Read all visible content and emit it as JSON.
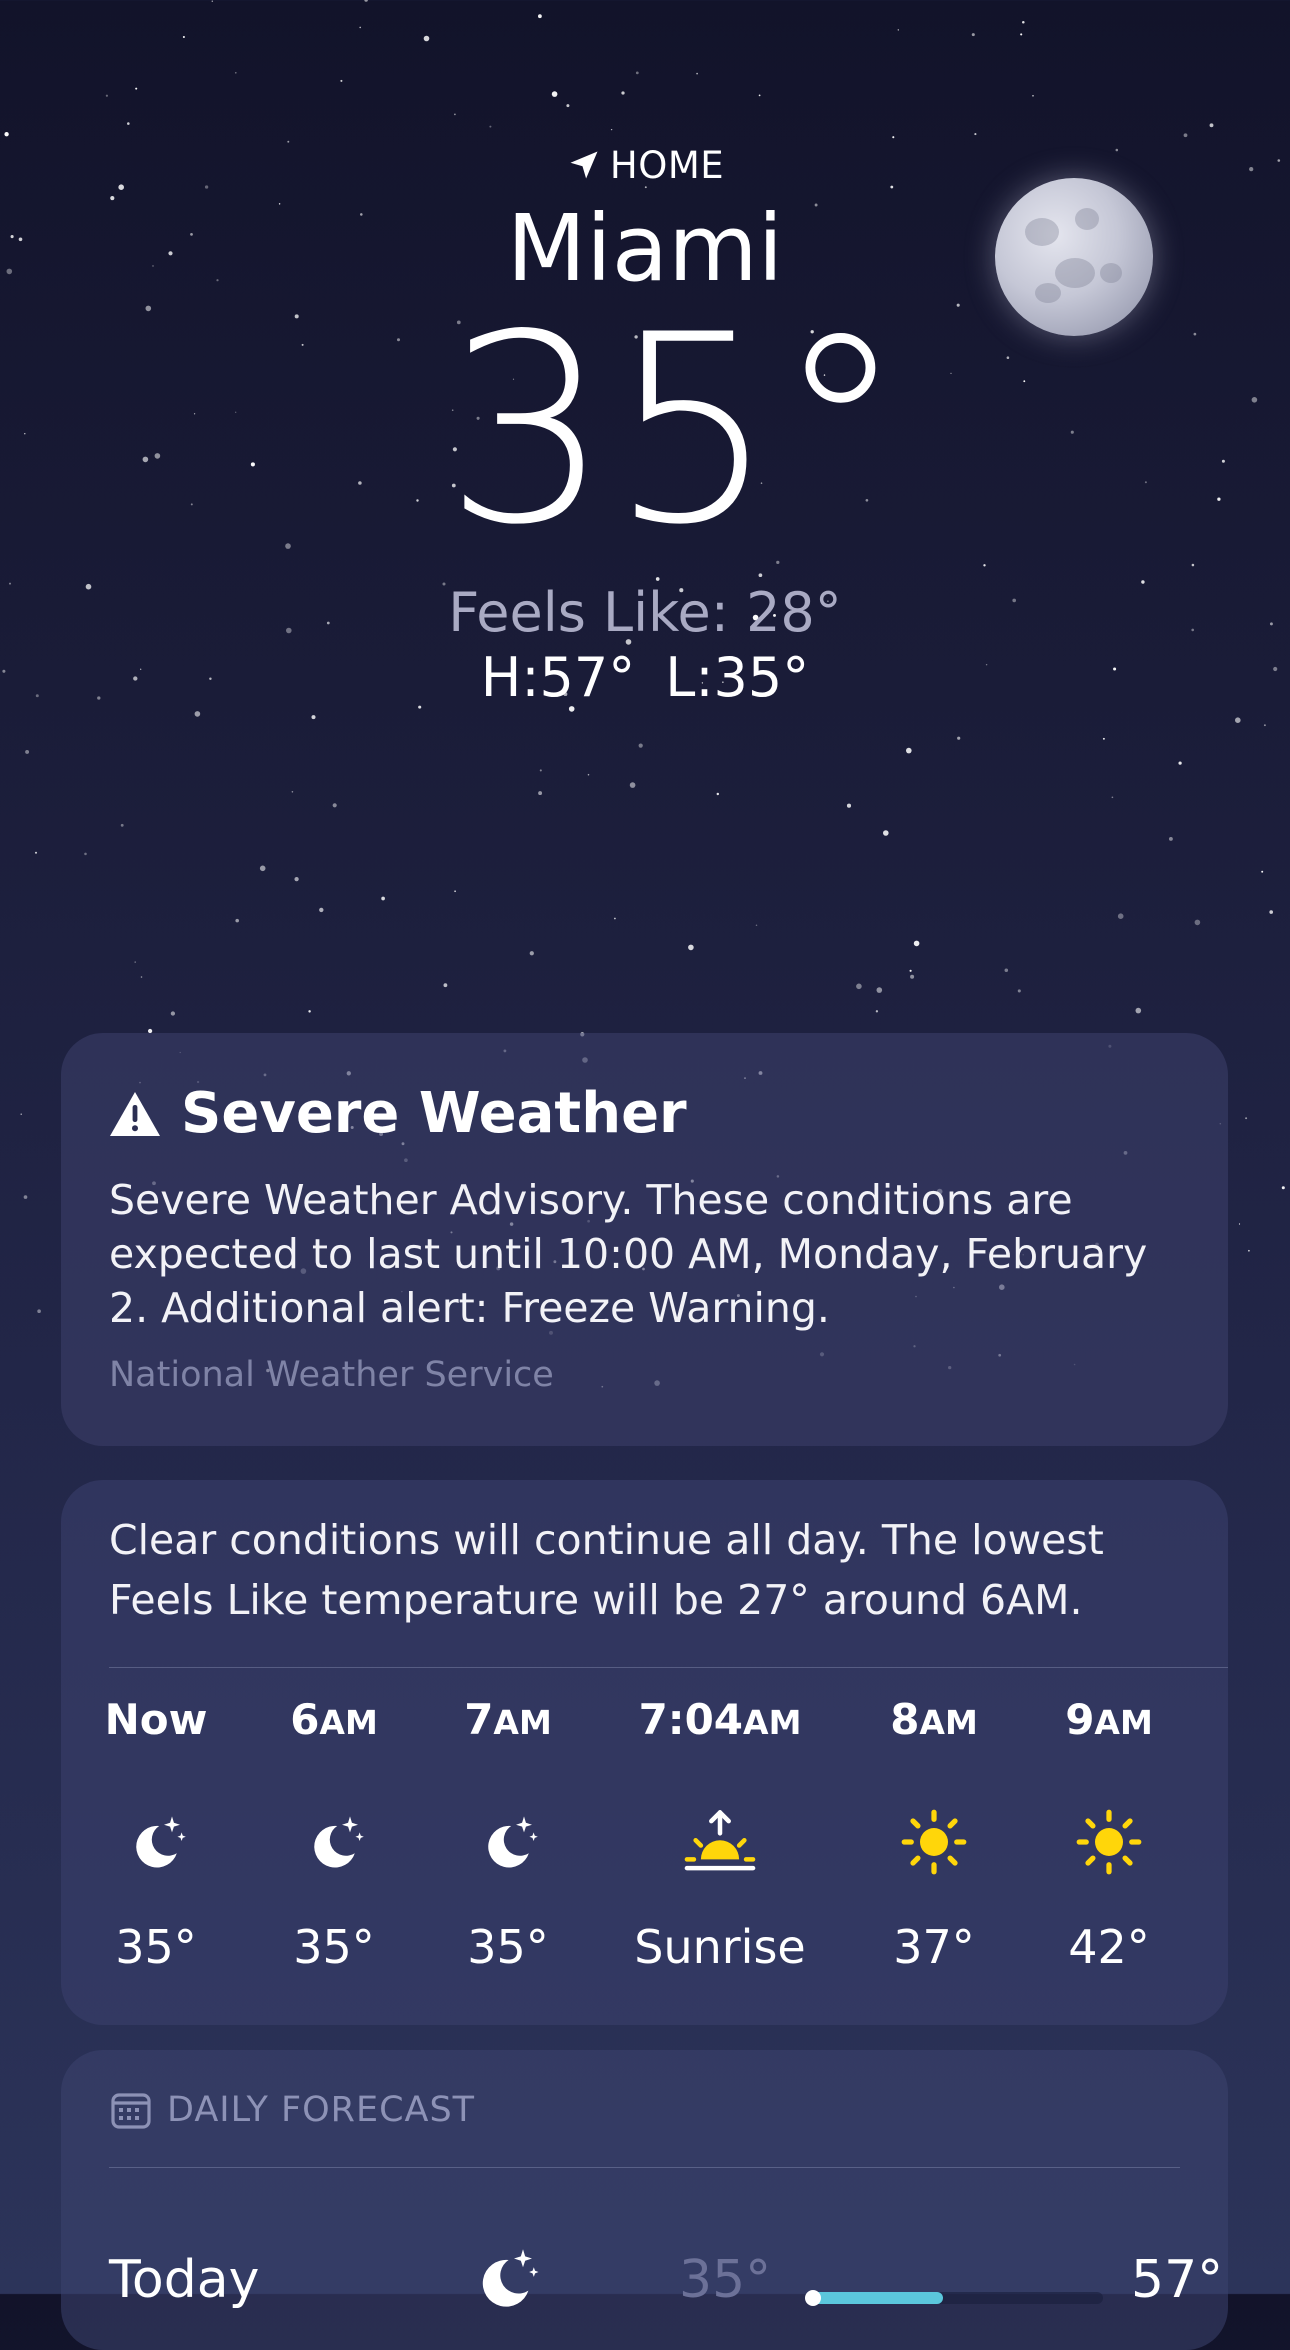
{
  "location": {
    "home_label": "HOME",
    "city": "Miami"
  },
  "current": {
    "temperature": "35°",
    "feels_like": "Feels Like: 28°",
    "high": "H:57°",
    "low": "L:35°"
  },
  "alert": {
    "title": "Severe Weather",
    "body": "Severe Weather Advisory. These conditions are expected to last until 10:00 AM, Monday, February 2. Additional alert: Freeze Warning.",
    "source": "National Weather Service"
  },
  "hourly": {
    "summary_line1": "Clear conditions will continue all day. The lowest",
    "summary_line2": "Feels Like temperature will be 27° around 6AM.",
    "items": [
      {
        "time": "Now",
        "period": "",
        "icon": "moon-stars-icon",
        "value": "35°"
      },
      {
        "time": "6",
        "period": "AM",
        "icon": "moon-stars-icon",
        "value": "35°"
      },
      {
        "time": "7",
        "period": "AM",
        "icon": "moon-stars-icon",
        "value": "35°"
      },
      {
        "time": "7:04",
        "period": "AM",
        "icon": "sunrise-icon",
        "value": "Sunrise"
      },
      {
        "time": "8",
        "period": "AM",
        "icon": "sun-icon",
        "value": "37°"
      },
      {
        "time": "9",
        "period": "AM",
        "icon": "sun-icon",
        "value": "42°"
      }
    ]
  },
  "daily": {
    "label": "DAILY FORECAST",
    "days": [
      {
        "name": "Today",
        "icon": "moon-stars-icon",
        "low": "35°",
        "high": "57°",
        "range_fill_fraction": 0.46
      }
    ]
  },
  "colors": {
    "sun": "#FFD60A",
    "bar_fill": "#5BC7DC"
  }
}
